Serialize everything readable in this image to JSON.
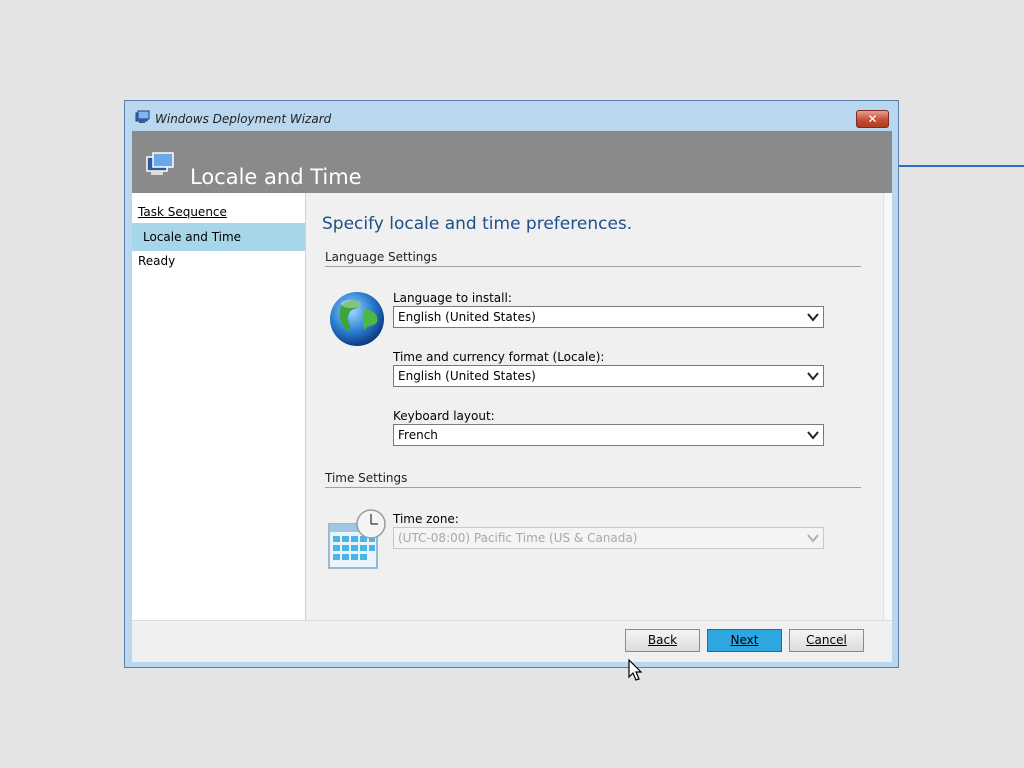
{
  "window": {
    "title": "Windows Deployment Wizard",
    "close_glyph": "✕"
  },
  "header": {
    "title": "Locale and Time",
    "icon": "computer-wizard-icon"
  },
  "nav": {
    "items": [
      {
        "label": "Task Sequence",
        "state": "link"
      },
      {
        "label": "Locale and Time",
        "state": "selected"
      },
      {
        "label": "Ready",
        "state": "normal"
      }
    ]
  },
  "main": {
    "heading": "Specify locale and time preferences.",
    "language_section": "Language Settings",
    "language_to_install": {
      "label": "Language to install:",
      "value": "English (United States)"
    },
    "locale_format": {
      "label": "Time and currency format (Locale):",
      "value": "English (United States)"
    },
    "keyboard_layout": {
      "label": "Keyboard layout:",
      "value": "French"
    },
    "time_section": "Time Settings",
    "time_zone": {
      "label": "Time zone:",
      "value": "(UTC-08:00) Pacific Time (US & Canada)",
      "enabled": false
    }
  },
  "footer": {
    "back_label": "Back",
    "next_label": "Next",
    "cancel_label": "Cancel"
  },
  "colors": {
    "accent": "#2ea7e0",
    "header_bg": "#8a8a8a",
    "nav_selected": "#a7d6ea",
    "heading_text": "#1e4e8c"
  }
}
